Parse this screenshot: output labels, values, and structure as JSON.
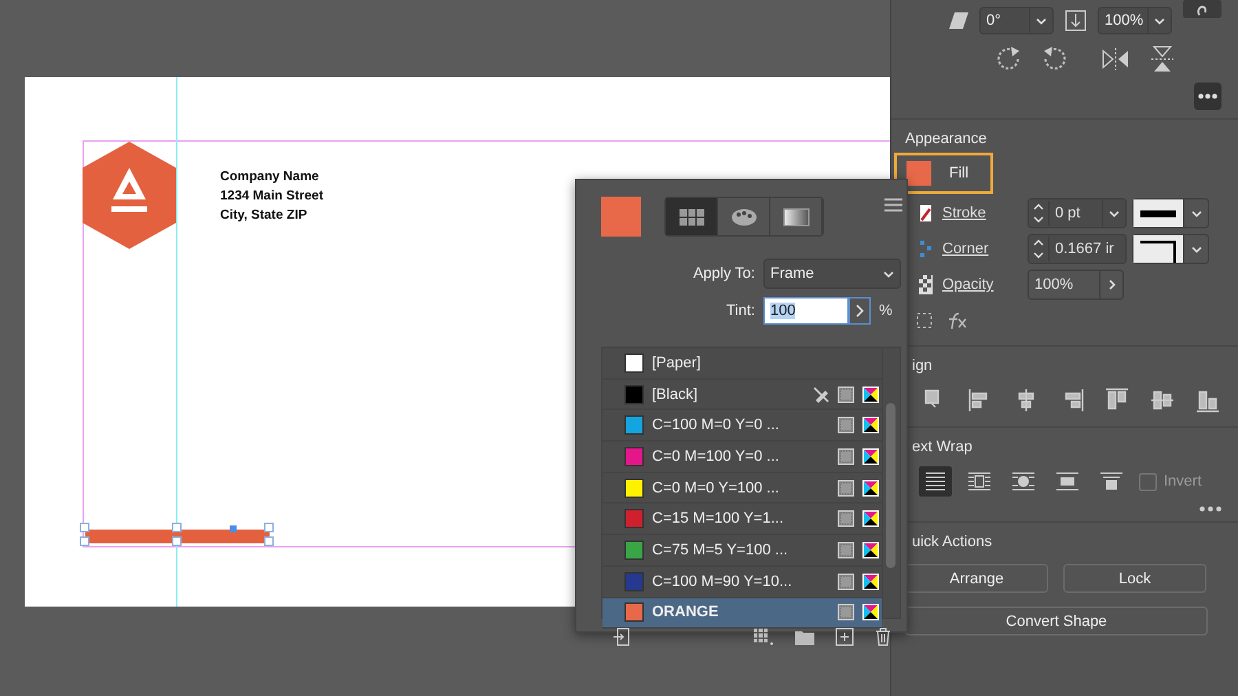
{
  "transform": {
    "rotation": "0°",
    "scale": "100%"
  },
  "appearance": {
    "title": "Appearance",
    "fill": {
      "label": "Fill",
      "selected": true
    },
    "stroke": {
      "label": "Stroke",
      "weight": "0 pt"
    },
    "corner": {
      "label": "Corner",
      "size": "0.1667 ir"
    },
    "opacity": {
      "label": "Opacity",
      "value": "100%"
    }
  },
  "align": {
    "title": "ign"
  },
  "text_wrap": {
    "title": "ext Wrap",
    "options": [
      {
        "kind": "none",
        "selected": true
      },
      {
        "kind": "bounding",
        "selected": false
      },
      {
        "kind": "shape",
        "selected": false
      },
      {
        "kind": "jump",
        "selected": false
      },
      {
        "kind": "next",
        "selected": false
      }
    ],
    "invert": {
      "label": "Invert",
      "checked": false
    }
  },
  "quick_actions": {
    "title": "uick Actions",
    "buttons": [
      "Arrange",
      "Lock",
      "Convert Shape"
    ]
  },
  "document": {
    "address_lines": [
      "Company Name",
      "1234 Main Street",
      "City, State ZIP"
    ]
  },
  "swatches": {
    "modes": [
      {
        "kind": "swatch",
        "selected": true
      },
      {
        "kind": "color",
        "selected": false
      },
      {
        "kind": "gradient",
        "selected": false
      }
    ],
    "apply_to_label": "Apply To:",
    "apply_to": "Frame",
    "tint_label": "Tint:",
    "tint": "100",
    "tint_unit": "%",
    "items": [
      {
        "name": "[Paper]",
        "color": "#ffffff",
        "editable": true,
        "process": false,
        "selected": false
      },
      {
        "name": "[Black]",
        "color": "#000000",
        "editable": false,
        "process": true,
        "selected": false
      },
      {
        "name": "C=100 M=0 Y=0 ...",
        "color": "#12a5e0",
        "editable": true,
        "process": true,
        "selected": false
      },
      {
        "name": "C=0 M=100 Y=0 ...",
        "color": "#e5168c",
        "editable": true,
        "process": true,
        "selected": false
      },
      {
        "name": "C=0 M=0 Y=100 ...",
        "color": "#fff200",
        "editable": true,
        "process": true,
        "selected": false
      },
      {
        "name": "C=15 M=100 Y=1...",
        "color": "#d0202e",
        "editable": true,
        "process": true,
        "selected": false
      },
      {
        "name": "C=75 M=5 Y=100 ...",
        "color": "#3aa547",
        "editable": true,
        "process": true,
        "selected": false
      },
      {
        "name": "C=100 M=90 Y=10...",
        "color": "#24398f",
        "editable": true,
        "process": true,
        "selected": false
      },
      {
        "name": "ORANGE",
        "color": "#e8694a",
        "editable": true,
        "process": true,
        "selected": true
      }
    ]
  }
}
